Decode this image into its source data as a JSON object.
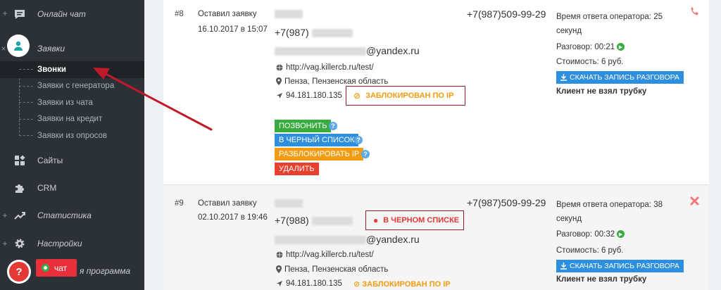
{
  "sidebar": {
    "items": [
      {
        "label": "Онлайн чат",
        "plus": "+",
        "icon": "chat-icon"
      },
      {
        "label": "Заявки",
        "plus": "×",
        "icon": "user-icon"
      },
      {
        "label": "Сайты",
        "icon": "sites-icon"
      },
      {
        "label": "CRM",
        "icon": "puzzle-icon"
      },
      {
        "label": "Статистика",
        "plus": "+",
        "icon": "chart-icon"
      },
      {
        "label": "Настройки",
        "plus": "+",
        "icon": "gear-icon"
      }
    ],
    "subitems": [
      "Звонки",
      "Заявки с генератора",
      "Заявки из чата",
      "Заявки на кредит",
      "Заявки из опросов"
    ],
    "partial_label": "я программа",
    "help_label": "?",
    "chat_label": "чат"
  },
  "records": [
    {
      "id": "#8",
      "left_label": "Оставил заявку",
      "date": "16.10.2017 в 15:07",
      "phone_prefix": "+7(987)",
      "email_suffix": "@yandex.ru",
      "site": "http://vag.killercb.ru/test/",
      "location": "Пенза, Пензенская область",
      "ip": "94.181.180.135",
      "status": "ЗАБЛОКИРОВАН ПО IP",
      "phone_main": "+7(987)509-99-29",
      "response_time": "Время ответа оператора: 25 секунд",
      "talk": "Разговор: 00:21",
      "cost": "Стоимость: 6 руб.",
      "download": "СКАЧАТЬ ЗАПИСЬ РАЗГОВОРА",
      "result": "Клиент не взял трубку",
      "buttons": [
        "ПОЗВОНИТЬ",
        "В ЧЕРНЫЙ СПИСОК",
        "РАЗБЛОКИРОВАТЬ IP",
        "УДАЛИТЬ"
      ]
    },
    {
      "id": "#9",
      "left_label": "Оставил заявку",
      "date": "02.10.2017 в 19:46",
      "phone_prefix": "+7(988)",
      "email_suffix": "@yandex.ru",
      "site": "http://vag.killercb.ru/test/",
      "location": "Пенза, Пензенская область",
      "ip": "94.181.180.135",
      "status": "В ЧЕРНОМ СПИСКЕ",
      "ip_status": "ЗАБЛОКИРОВАН ПО IP",
      "phone_main": "+7(987)509-99-29",
      "response_time": "Время ответа оператора: 38 секунд",
      "talk": "Разговор: 00:32",
      "cost": "Стоимость: 6 руб.",
      "download": "СКАЧАТЬ ЗАПИСЬ РАЗГОВОРА",
      "result": "Клиент не взял трубку"
    }
  ],
  "colors": {
    "sidebar_bg": "#2c3137",
    "accent_red": "#e53935",
    "orange": "#f39c12",
    "blue": "#2f8fdf",
    "green": "#3aab3f"
  }
}
